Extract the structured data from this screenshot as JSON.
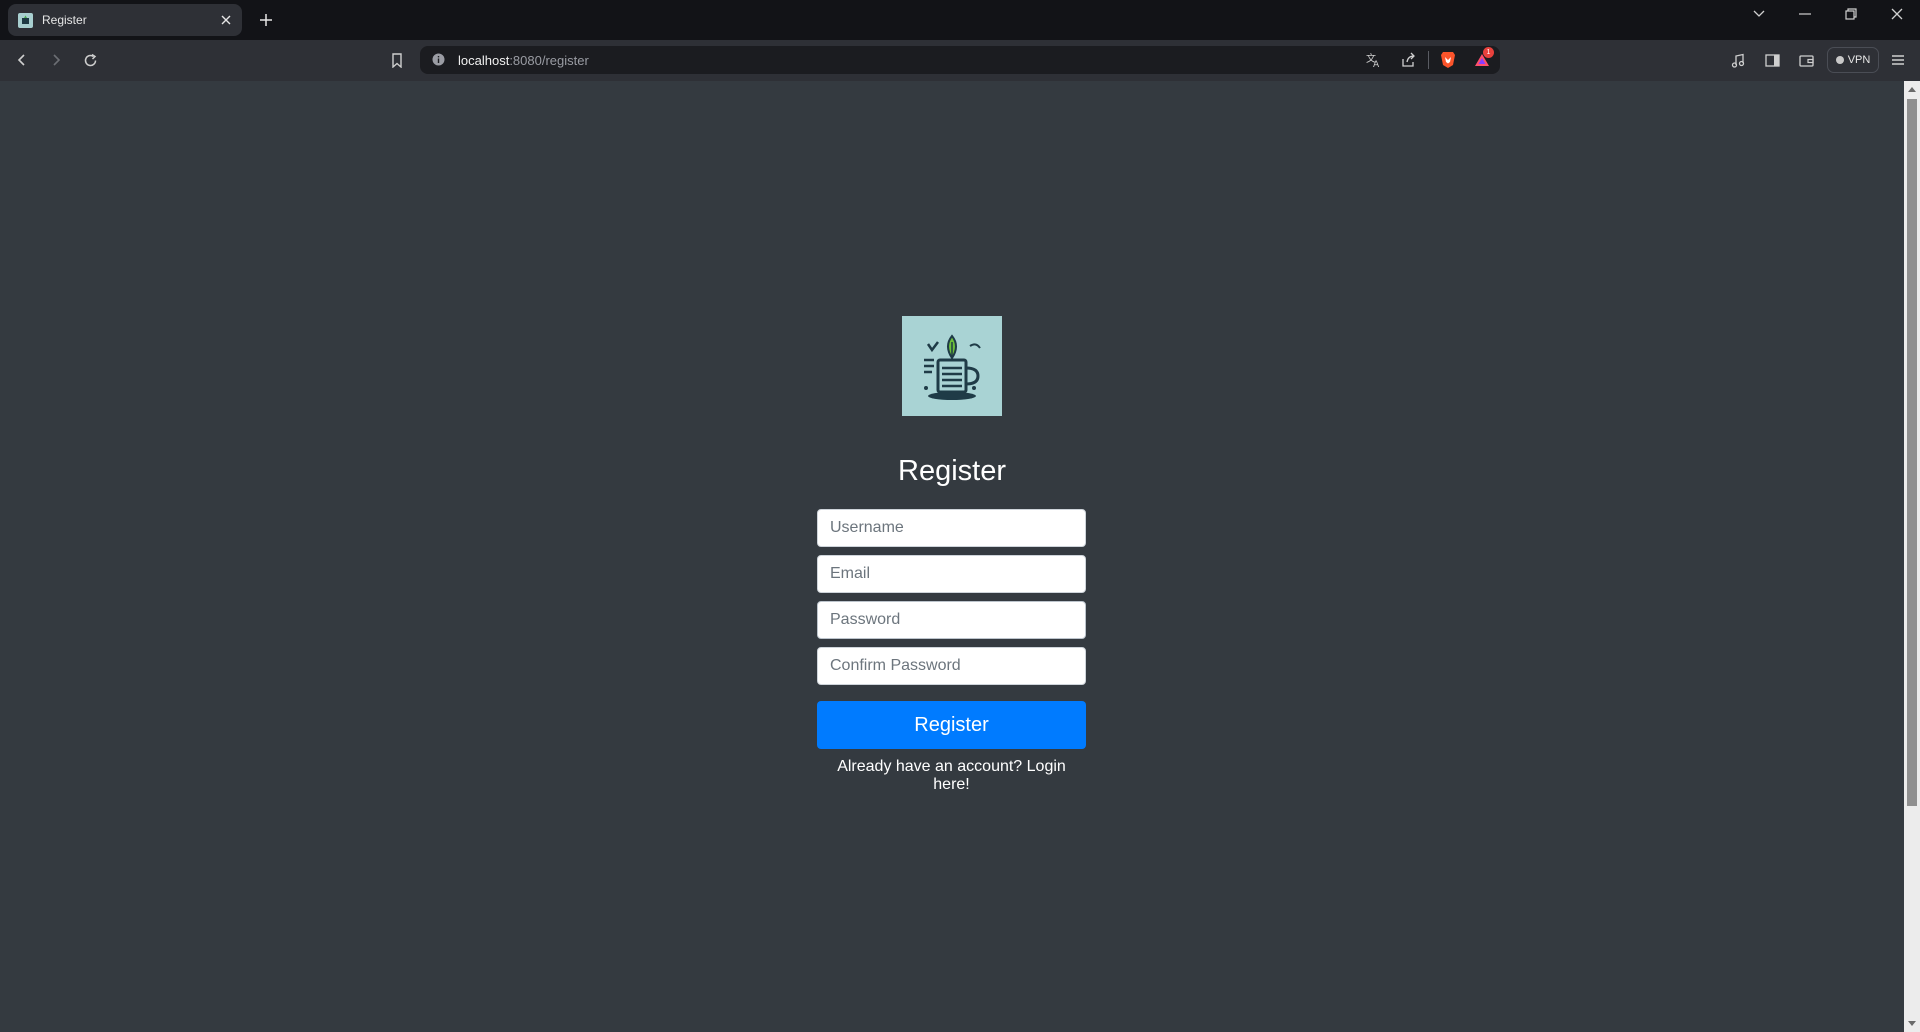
{
  "browser": {
    "tab_title": "Register",
    "url_host": "localhost",
    "url_path": ":8080/register",
    "vpn_label": "VPN",
    "notification_count": "1"
  },
  "page": {
    "logo_alt": "Task list with leaf logo",
    "heading": "Register",
    "fields": {
      "username": {
        "placeholder": "Username",
        "value": ""
      },
      "email": {
        "placeholder": "Email",
        "value": ""
      },
      "password": {
        "placeholder": "Password",
        "value": ""
      },
      "confirm_password": {
        "placeholder": "Confirm Password",
        "value": ""
      }
    },
    "submit_label": "Register",
    "login_prompt": "Already have an account?",
    "login_link": "Login here!"
  },
  "colors": {
    "page_bg": "#343a40",
    "primary": "#007bff",
    "logo_bg": "#a9d3d4"
  }
}
